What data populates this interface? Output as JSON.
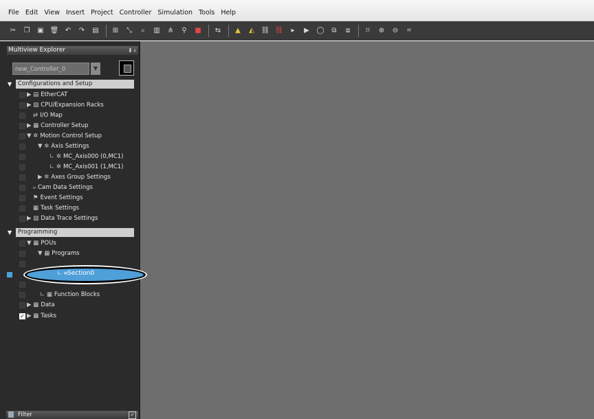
{
  "menubar": {
    "items": [
      "File",
      "Edit",
      "View",
      "Insert",
      "Project",
      "Controller",
      "Simulation",
      "Tools",
      "Help"
    ]
  },
  "toolbar": {
    "icons": [
      "cut-icon",
      "copy-icon",
      "paste-icon",
      "delete-icon",
      "undo-icon",
      "redo-icon",
      "build-icon",
      "variable-table-icon",
      "cross-reference-icon",
      "search-replace-icon",
      "find-icon",
      "monitor-icon",
      "online-icon",
      "warning-icon",
      "alert-icon",
      "link-icon",
      "disconnect-icon",
      "transfer-icon",
      "program-mode-icon",
      "run-mode-icon",
      "zoom-fit-icon",
      "zoom-in-icon",
      "zoom-out-icon",
      "zoom-reset-icon"
    ]
  },
  "explorer": {
    "title": "Multiview Explorer",
    "pin": "⬇ ᵼ",
    "controller_select": {
      "value": "new_Controller_0",
      "arrow": "▼"
    },
    "config_section": "Configurations and Setup",
    "config_items": [
      {
        "label": "EtherCAT",
        "prefix": "▶ ▤"
      },
      {
        "label": "CPU/Expansion Racks",
        "prefix": "▶ ▨"
      },
      {
        "label": "I/O Map",
        "prefix": "⇄"
      },
      {
        "label": "Controller Setup",
        "prefix": "▶ ▦"
      },
      {
        "label": "Motion Control Setup",
        "prefix": "▼ ✲"
      },
      {
        "label": "Axis Settings",
        "prefix": "▼ ✲"
      },
      {
        "label": "MC_Axis000 (0,MC1)",
        "prefix": "∟ ✲"
      },
      {
        "label": "MC_Axis001 (1,MC1)",
        "prefix": "∟ ✲"
      },
      {
        "label": "Axes Group Settings",
        "prefix": "▶ ✲"
      },
      {
        "label": "Cam Data Settings",
        "prefix": "ℴ"
      },
      {
        "label": "Event Settings",
        "prefix": "⚑"
      },
      {
        "label": "Task Settings",
        "prefix": "▦"
      },
      {
        "label": "Data Trace Settings",
        "prefix": "▶ ▨"
      }
    ],
    "programming_section": "Programming",
    "prog_items": [
      {
        "label": "POUs",
        "prefix": "▼ ▦"
      },
      {
        "label": "Programs",
        "prefix": "▼ ▦"
      },
      {
        "label": "Function Blocks",
        "prefix": "∟ ▦"
      },
      {
        "label": "Data",
        "prefix": "▶ ▦"
      },
      {
        "label": "Tasks",
        "prefix": "▶ ▦"
      }
    ],
    "selected_item": "Section0",
    "selected_prefix": "∟ ≡",
    "check_mark": "✓",
    "filter": {
      "label": "Filter",
      "expand": "✓"
    }
  }
}
